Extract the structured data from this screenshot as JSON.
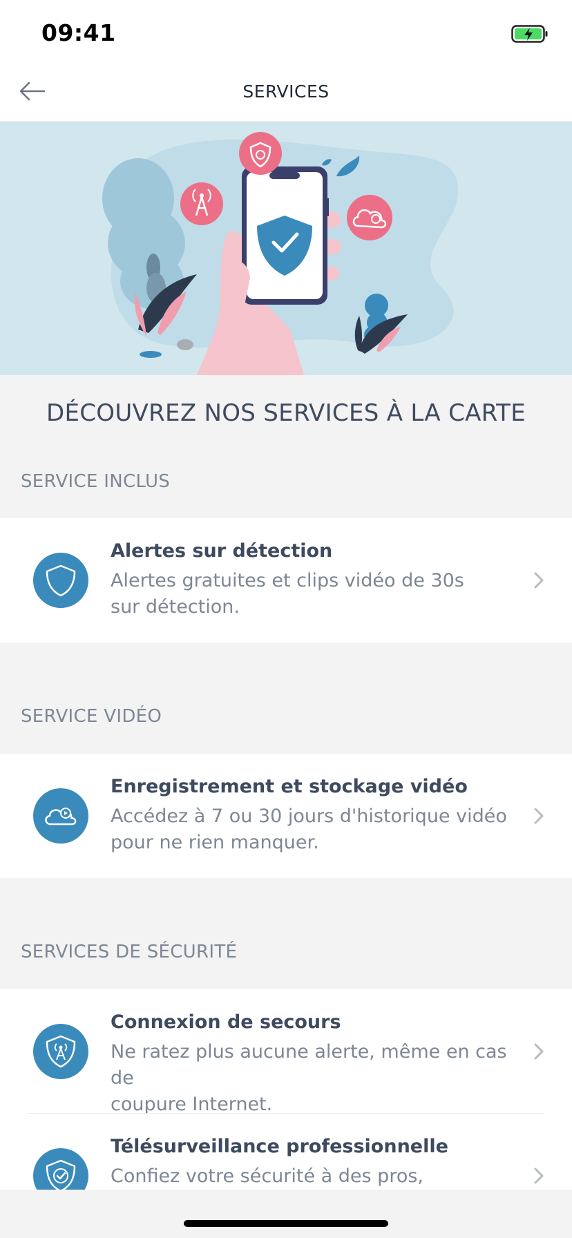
{
  "status_bar": {
    "time": "09:41",
    "battery_icon": "battery-charging-icon",
    "battery_color": "#4cd964"
  },
  "nav": {
    "title": "SERVICES",
    "back_icon": "arrow-left-icon"
  },
  "hero": {
    "illustration": "phone-shield-illustration",
    "bg_color": "#d2e6ee"
  },
  "heading": "DÉCOUVREZ NOS SERVICES À LA CARTE",
  "sections": [
    {
      "header": "SERVICE INCLUS",
      "items": [
        {
          "title": "Alertes sur détection",
          "desc_line1": "Alertes gratuites et clips vidéo de 30s",
          "desc_line2": "sur détection.",
          "icon": "shield-icon"
        }
      ]
    },
    {
      "header": "SERVICE VIDÉO",
      "items": [
        {
          "title": "Enregistrement et stockage vidéo",
          "desc_line1": "Accédez à 7 ou 30 jours d'historique vidéo",
          "desc_line2": "pour ne rien manquer.",
          "icon": "cloud-play-icon"
        }
      ]
    },
    {
      "header": "SERVICES DE SÉCURITÉ",
      "items": [
        {
          "title": "Connexion de secours",
          "desc_line1": "Ne ratez plus aucune alerte, même en cas de",
          "desc_line2": "coupure Internet.",
          "icon": "antenna-shield-icon"
        },
        {
          "title": "Télésurveillance professionnelle",
          "desc_line1": "Confiez votre sécurité à des pros,",
          "desc_line2": "",
          "icon": "shield-check-icon"
        }
      ]
    }
  ],
  "colors": {
    "accent": "#3a8bbb",
    "title_text": "#3e4a5e",
    "secondary_text": "#7d8794",
    "background": "#f3f3f4",
    "hero_pink": "#ec6f87"
  }
}
